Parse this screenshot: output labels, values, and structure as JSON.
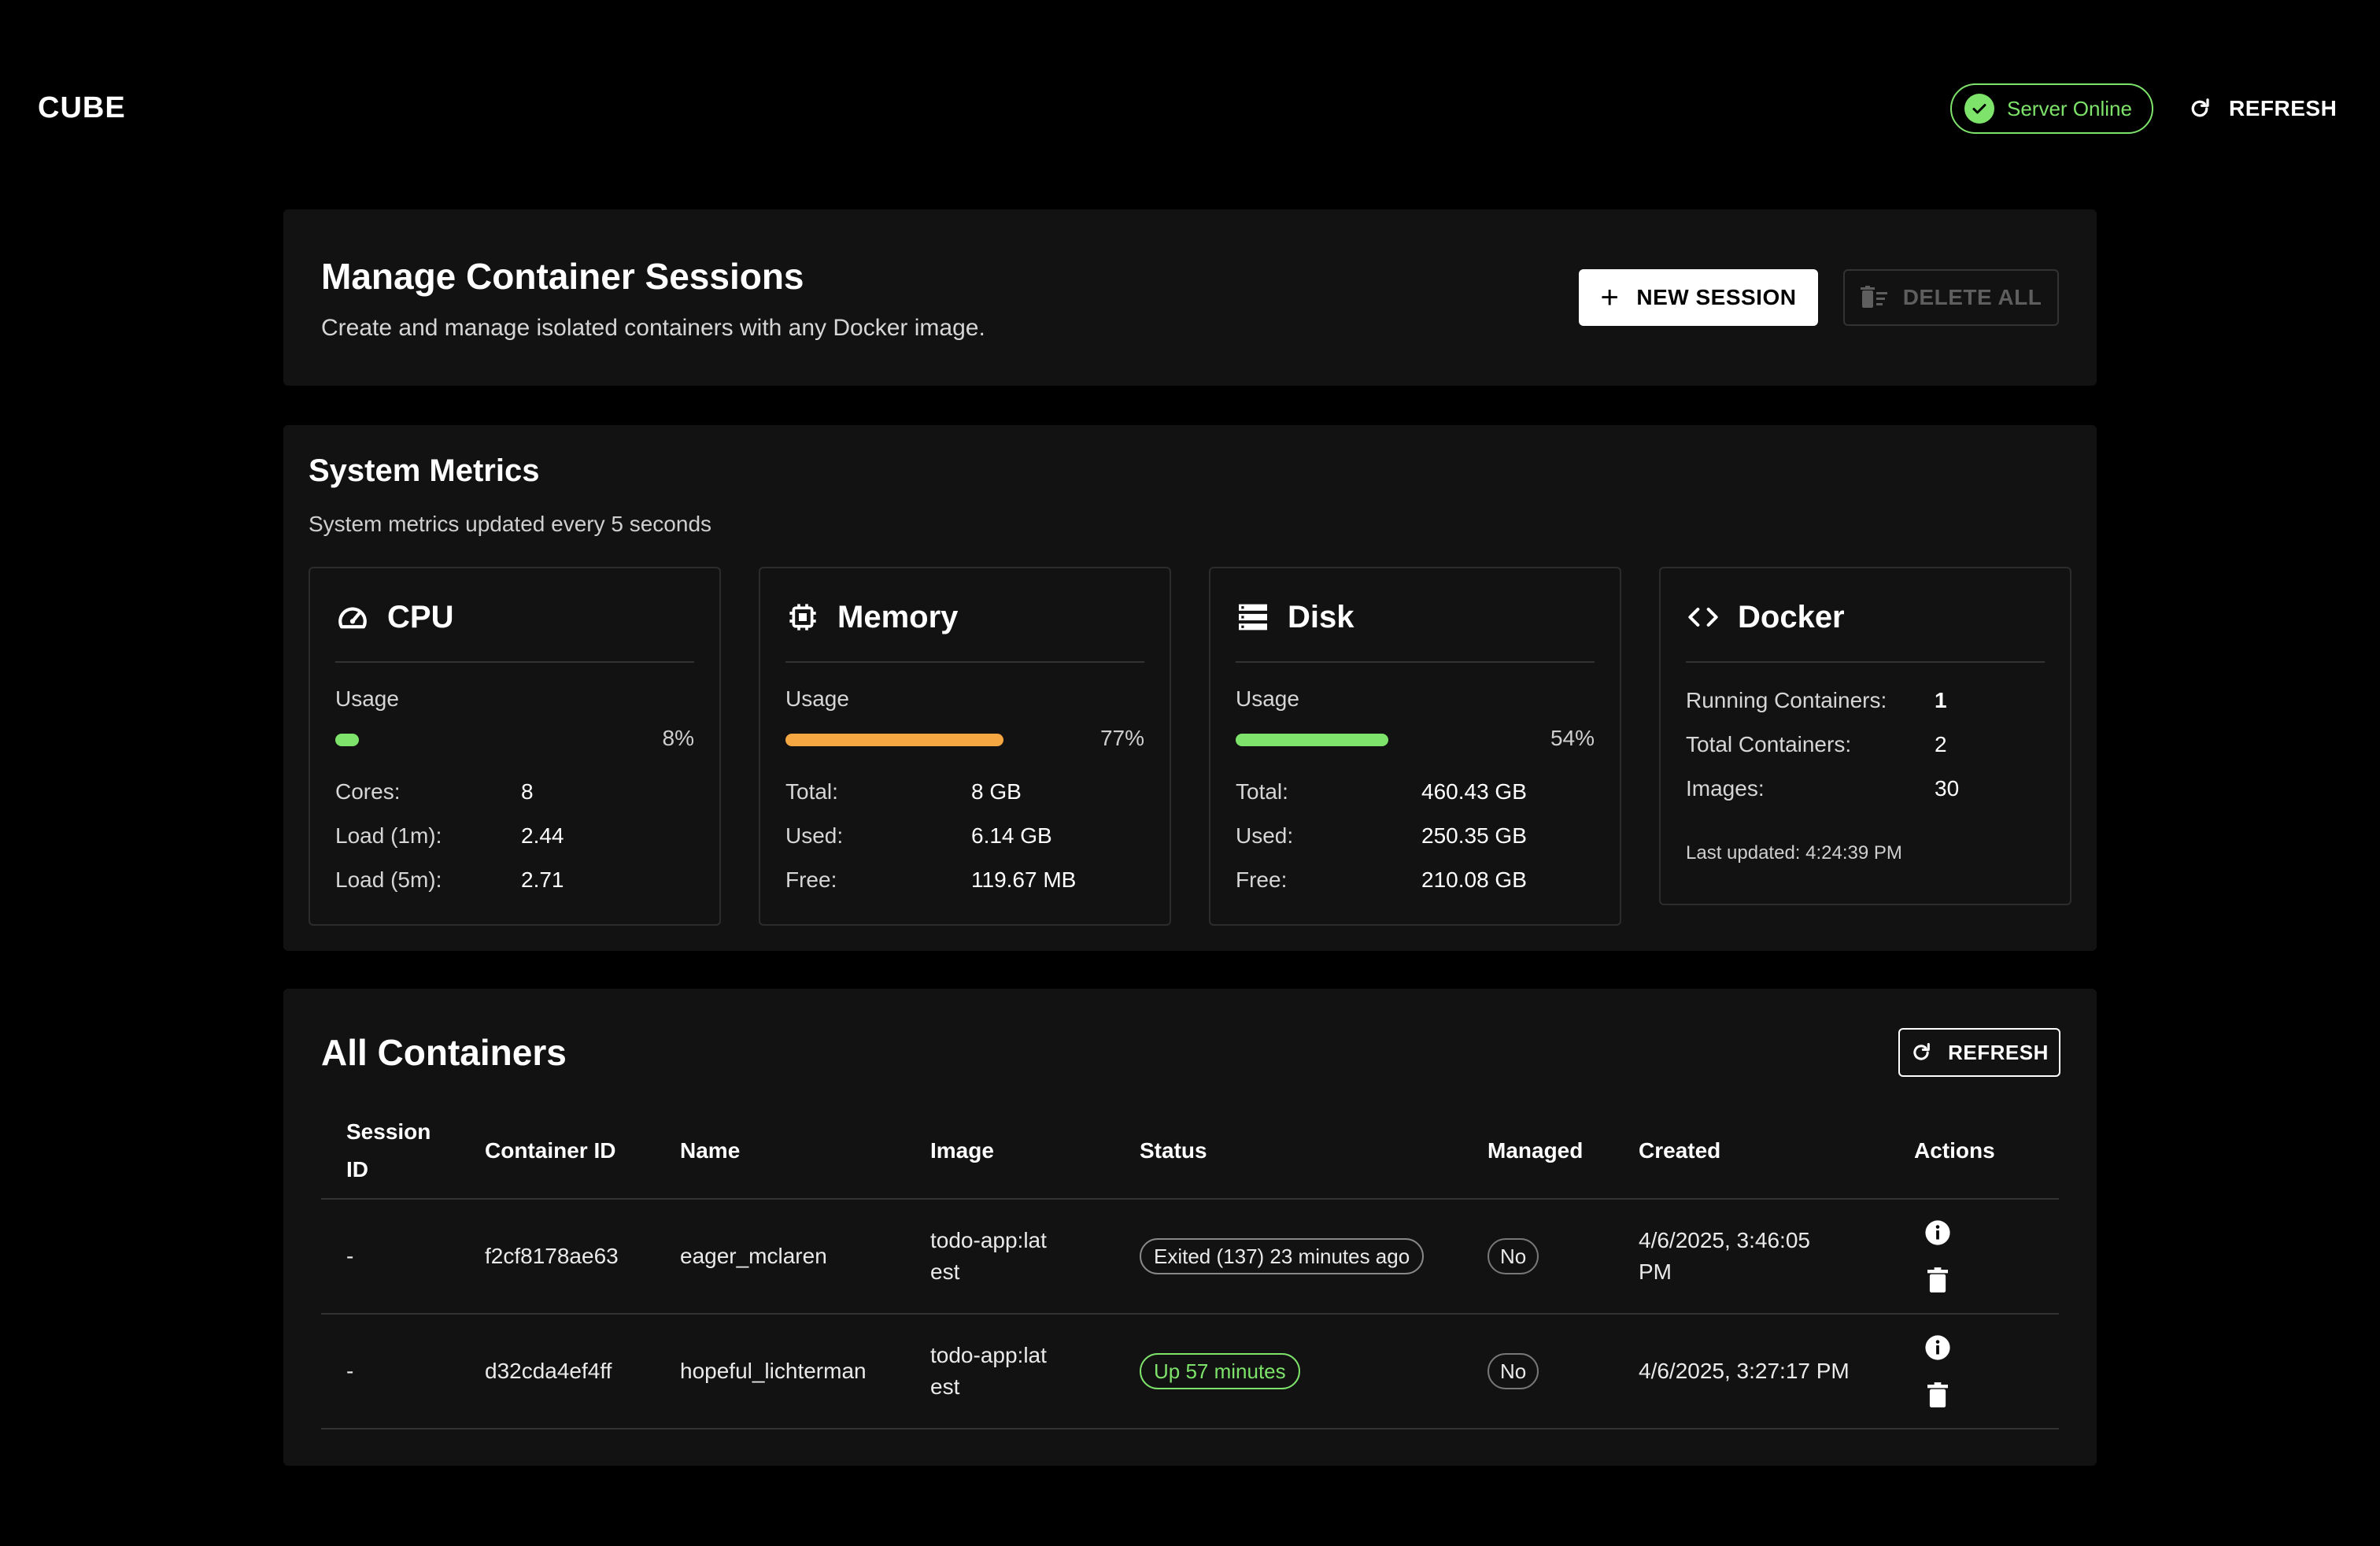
{
  "header": {
    "brand": "CUBE",
    "status": "Server Online",
    "refresh_label": "REFRESH"
  },
  "manage": {
    "title": "Manage Container Sessions",
    "subtitle": "Create and manage isolated containers with any Docker image.",
    "new_session_label": "NEW SESSION",
    "delete_all_label": "DELETE ALL"
  },
  "metrics": {
    "title": "System Metrics",
    "subtitle": "System metrics updated every 5 seconds",
    "cpu": {
      "name": "CPU",
      "usage_label": "Usage",
      "usage_pct": 8,
      "usage_text": "8%",
      "bar_color": "#7ee36a",
      "rows": [
        {
          "k": "Cores:",
          "v": "8"
        },
        {
          "k": "Load (1m):",
          "v": "2.44"
        },
        {
          "k": "Load (5m):",
          "v": "2.71"
        }
      ]
    },
    "memory": {
      "name": "Memory",
      "usage_label": "Usage",
      "usage_pct": 77,
      "usage_text": "77%",
      "bar_color": "#f5a742",
      "rows": [
        {
          "k": "Total:",
          "v": "8 GB"
        },
        {
          "k": "Used:",
          "v": "6.14 GB"
        },
        {
          "k": "Free:",
          "v": "119.67 MB"
        }
      ]
    },
    "disk": {
      "name": "Disk",
      "usage_label": "Usage",
      "usage_pct": 54,
      "usage_text": "54%",
      "bar_color": "#7ee36a",
      "rows": [
        {
          "k": "Total:",
          "v": "460.43 GB"
        },
        {
          "k": "Used:",
          "v": "250.35 GB"
        },
        {
          "k": "Free:",
          "v": "210.08 GB"
        }
      ]
    },
    "docker": {
      "name": "Docker",
      "rows": [
        {
          "k": "Running Containers:",
          "v": "1"
        },
        {
          "k": "Total Containers:",
          "v": "2"
        },
        {
          "k": "Images:",
          "v": "30"
        }
      ],
      "updated": "Last updated: 4:24:39 PM"
    }
  },
  "containers": {
    "title": "All Containers",
    "refresh_label": "REFRESH",
    "columns": [
      "Session ID",
      "Container ID",
      "Name",
      "Image",
      "Status",
      "Managed",
      "Created",
      "Actions"
    ],
    "rows": [
      {
        "session_id": "-",
        "container_id": "f2cf8178ae63",
        "name": "eager_mclaren",
        "image": "todo-app:latest",
        "status": "Exited (137) 23 minutes ago",
        "managed": "No",
        "created": "4/6/2025, 3:46:05 PM"
      },
      {
        "session_id": "-",
        "container_id": "d32cda4ef4ff",
        "name": "hopeful_lichterman",
        "image": "todo-app:latest",
        "status": "Up 57 minutes",
        "managed": "No",
        "created": "4/6/2025, 3:27:17 PM"
      }
    ]
  },
  "icons": {
    "status": "check-circle-icon",
    "refresh": "refresh-icon",
    "new_session": "plus-icon",
    "delete_all": "delete-sweep-icon",
    "cpu": "speedometer-icon",
    "memory": "chip-icon",
    "disk": "storage-icon",
    "docker": "code-icon",
    "info": "info-icon",
    "delete": "trash-icon"
  },
  "colors": {
    "accent_green": "#7ee36a",
    "memory_orange": "#f5a742",
    "card_bg": "#121212"
  }
}
